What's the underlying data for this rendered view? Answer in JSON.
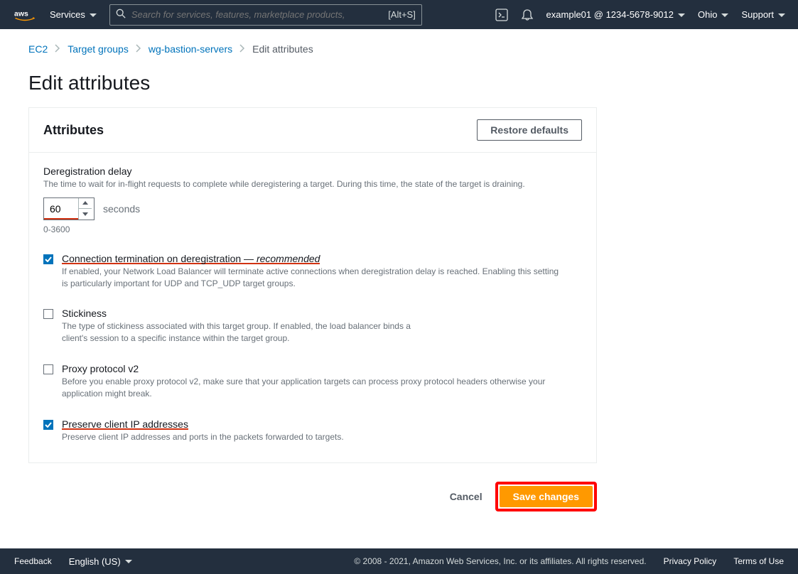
{
  "nav": {
    "services_label": "Services",
    "search_placeholder": "Search for services, features, marketplace products, and",
    "search_shortcut": "[Alt+S]",
    "account_label": "example01 @ 1234-5678-9012",
    "region_label": "Ohio",
    "support_label": "Support"
  },
  "breadcrumbs": {
    "item_0": "EC2",
    "item_1": "Target groups",
    "item_2": "wg-bastion-servers",
    "item_3": "Edit attributes"
  },
  "page": {
    "title": "Edit attributes"
  },
  "card": {
    "heading": "Attributes",
    "restore_defaults_label": "Restore defaults"
  },
  "dereg": {
    "label": "Deregistration delay",
    "help": "The time to wait for in-flight requests to complete while deregistering a target. During this time, the state of the target is draining.",
    "value": "60",
    "unit": "seconds",
    "range": "0-3600"
  },
  "opts": {
    "o0": {
      "checked": true,
      "title_main": "Connection termination on deregistration — ",
      "title_em": "recommended",
      "desc": "If enabled, your Network Load Balancer will terminate active connections when deregistration delay is reached. Enabling this setting is particularly important for UDP and TCP_UDP target groups."
    },
    "o1": {
      "checked": false,
      "title": "Stickiness",
      "desc": "The type of stickiness associated with this target group. If enabled, the load balancer binds a client's session to a specific instance within the target group."
    },
    "o2": {
      "checked": false,
      "title": "Proxy protocol v2",
      "desc": "Before you enable proxy protocol v2, make sure that your application targets can process proxy protocol headers otherwise your application might break."
    },
    "o3": {
      "checked": true,
      "title": "Preserve client IP addresses",
      "desc": "Preserve client IP addresses and ports in the packets forwarded to targets."
    }
  },
  "actions": {
    "cancel_label": "Cancel",
    "save_label": "Save changes"
  },
  "footer": {
    "feedback_label": "Feedback",
    "language_label": "English (US)",
    "copyright": "© 2008 - 2021, Amazon Web Services, Inc. or its affiliates. All rights reserved.",
    "privacy_label": "Privacy Policy",
    "terms_label": "Terms of Use"
  }
}
